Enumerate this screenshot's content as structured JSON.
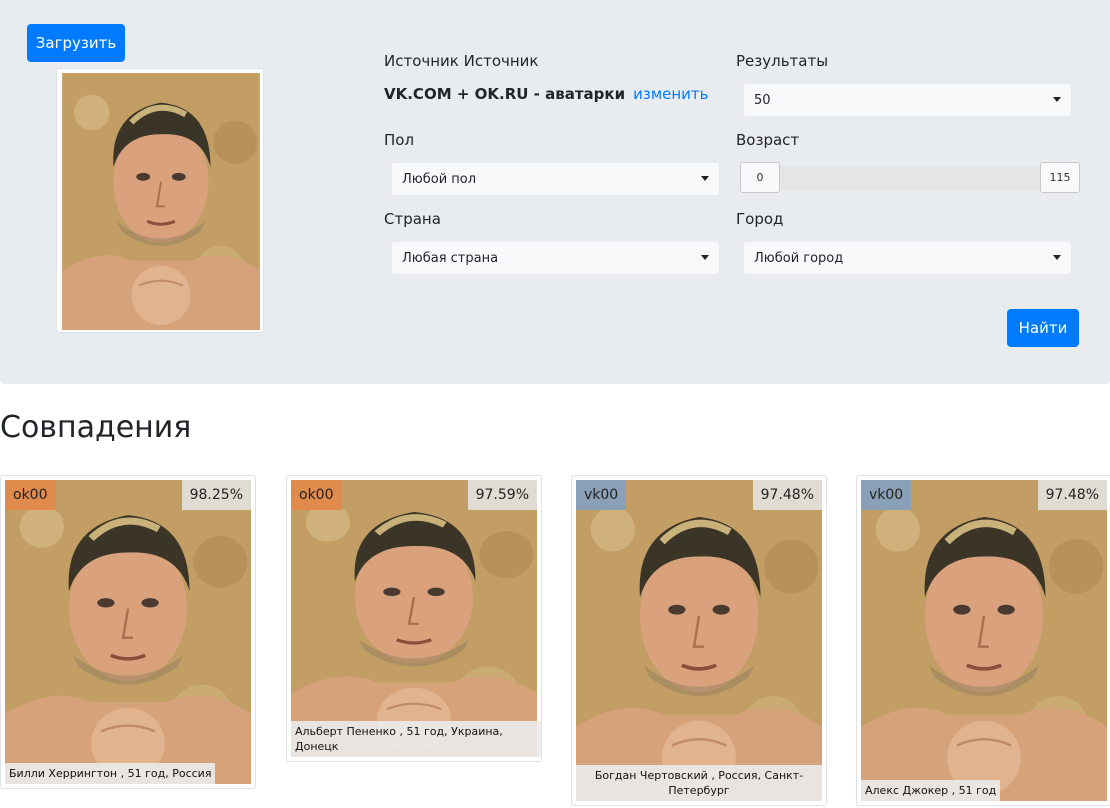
{
  "search": {
    "upload_label": "Загрузить",
    "source_label": "Источник Источник",
    "source_value": "VK.COM + OK.RU - аватарки",
    "change_label": "изменить",
    "results_label": "Результаты",
    "results_value": "50",
    "gender_label": "Пол",
    "gender_value": "Любой пол",
    "age_label": "Возраст",
    "age_min": "0",
    "age_max": "115",
    "country_label": "Страна",
    "country_value": "Любая страна",
    "city_label": "Город",
    "city_value": "Любой город",
    "find_label": "Найти"
  },
  "matches": {
    "title": "Совпадения",
    "items": [
      {
        "source": "ok00",
        "score": "98.25%",
        "caption": "Билли Херрингтон , 51 год, Россия"
      },
      {
        "source": "ok00",
        "score": "97.59%",
        "caption": "Альберт Пененко , 51 год, Украина, Донецк"
      },
      {
        "source": "vk00",
        "score": "97.48%",
        "caption": "Богдан Чертовский , Россия, Санкт-Петербург"
      },
      {
        "source": "vk00",
        "score": "97.48%",
        "caption": "Алекс Джокер , 51 год"
      }
    ]
  },
  "colors": {
    "primary": "#007bff",
    "panel_bg": "#e9ecef",
    "ok_badge": "#e08a4c",
    "vk_badge": "#8aa0b8"
  }
}
